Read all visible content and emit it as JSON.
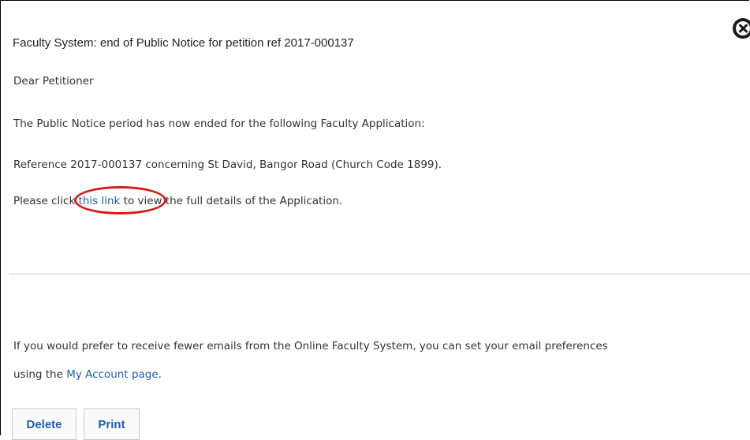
{
  "message": {
    "subject": "Faculty System: end of Public Notice for petition ref 2017-000137",
    "greeting": "Dear Petitioner",
    "notice": "The Public Notice period has now ended for the following Faculty Application:",
    "reference": "Reference 2017-000137 concerning St David, Bangor Road (Church Code 1899).",
    "details_prefix": "Please click ",
    "details_link": "this link",
    "details_suffix": " to view the full details of the Application.",
    "prefs_text": "If you would prefer to receive fewer emails from the Online Faculty System, you can set your email preferences",
    "prefs_prefix": "using the ",
    "prefs_link": "My Account page",
    "prefs_suffix": "."
  },
  "actions": {
    "delete_label": "Delete",
    "print_label": "Print"
  },
  "icons": {
    "close": "close-icon"
  },
  "colors": {
    "link": "#1f5fb0",
    "highlight": "#d91a1a"
  }
}
